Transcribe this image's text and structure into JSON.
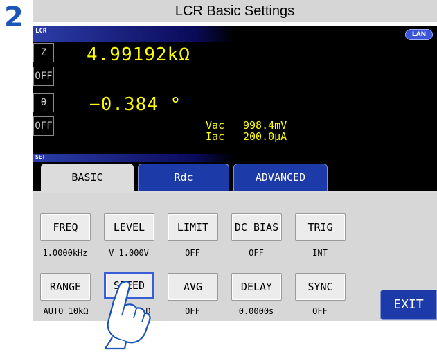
{
  "step_number": "2",
  "title": "LCR Basic Settings",
  "status_bar": {
    "mode": "LCR",
    "lan": "LAN"
  },
  "measurement": {
    "param1": "Z",
    "param1_off": "OFF",
    "param1_value": "4.99192kΩ",
    "param2": "θ",
    "param2_off": "OFF",
    "param2_value": "−0.384 °",
    "vac_label": "Vac",
    "vac_value": "998.4mV",
    "iac_label": "Iac",
    "iac_value": "200.0μA"
  },
  "set_bar": {
    "label": "SET"
  },
  "tabs": [
    {
      "label": "BASIC"
    },
    {
      "label": "Rdc"
    },
    {
      "label": "ADVANCED"
    }
  ],
  "row1": [
    {
      "label": "FREQ",
      "value": "1.0000kHz"
    },
    {
      "label": "LEVEL",
      "value": "V 1.000V"
    },
    {
      "label": "LIMIT",
      "value": "OFF"
    },
    {
      "label": "DC BIAS",
      "value": "OFF"
    },
    {
      "label": "TRIG",
      "value": "INT"
    }
  ],
  "row2": [
    {
      "label": "RANGE",
      "value": "AUTO  10kΩ"
    },
    {
      "label": "SPEED",
      "value": "D"
    },
    {
      "label": "AVG",
      "value": "OFF"
    },
    {
      "label": "DELAY",
      "value": "0.0000s"
    },
    {
      "label": "SYNC",
      "value": "OFF"
    }
  ],
  "exit_label": "EXIT",
  "colors": {
    "accent": "#1c3aa8",
    "measure": "#ffff00",
    "step": "#1a55b8"
  }
}
